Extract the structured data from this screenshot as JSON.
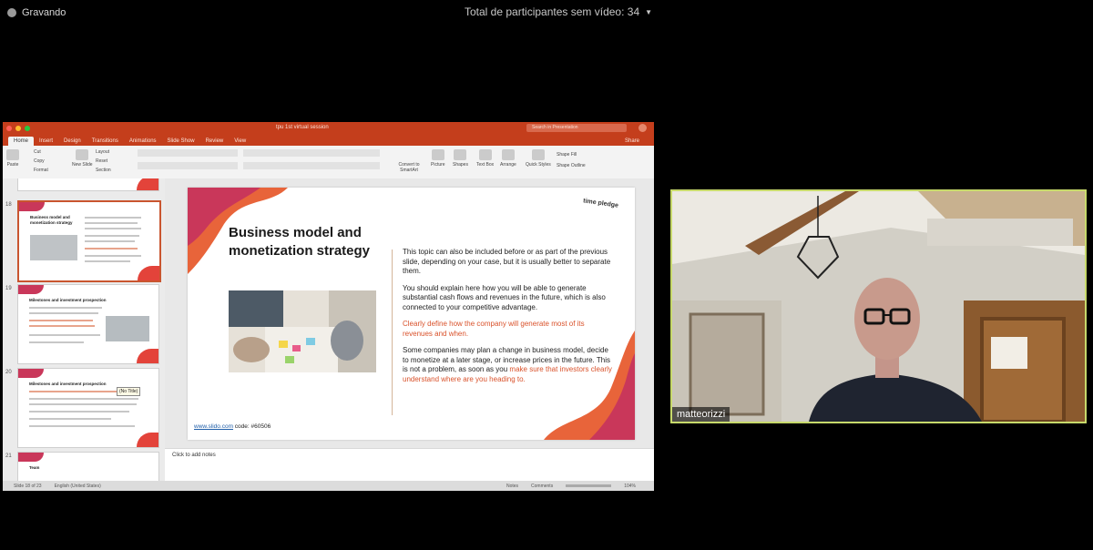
{
  "recording": {
    "label": "Gravando"
  },
  "meeting": {
    "participants_label": "Total de participantes sem vídeo: 34"
  },
  "ppt": {
    "window_title": "tpu 1st virtual session",
    "search_placeholder": "Search in Presentation",
    "tabs": [
      "Home",
      "Insert",
      "Design",
      "Transitions",
      "Animations",
      "Slide Show",
      "Review",
      "View"
    ],
    "active_tab": "Home",
    "share_label": "Share",
    "ribbon": {
      "paste": "Paste",
      "cut": "Cut",
      "copy": "Copy",
      "format": "Format",
      "new_slide": "New Slide",
      "layout": "Layout",
      "reset": "Reset",
      "section": "Section",
      "convert": "Convert to SmartArt",
      "picture": "Picture",
      "shapes": "Shapes",
      "textbox": "Text Box",
      "arrange": "Arrange",
      "quick_styles": "Quick Styles",
      "shape_fill": "Shape Fill",
      "shape_outline": "Shape Outline"
    },
    "thumbnails": [
      {
        "num": "18",
        "title": "Business model and monetization strategy",
        "selected": true
      },
      {
        "num": "19",
        "title": "Milestones and investment prospection",
        "selected": false
      },
      {
        "num": "20",
        "title": "Milestones and investment prospection",
        "selected": false
      },
      {
        "num": "21",
        "title": "Team",
        "selected": false
      }
    ],
    "tooltip": "(No Title)",
    "slide": {
      "title": "Business model and monetization strategy",
      "para1": "This topic can also be included before or as part of the previous slide, depending on your case, but it is usually better to separate them.",
      "para2": "You should explain here how you will be able to generate substantial cash flows and revenues in the future, which is also connected to your competitive advantage.",
      "para3": "Clearly define how the company will generate most of its revenues and when.",
      "para4_a": "Some companies may plan a change in business model, decide to monetize at a later stage, or increase prices in the future. This is not a problem, as soon as you ",
      "para4_b": "make sure that investors clearly understand where are you heading to.",
      "footer_link": "www.slido.com",
      "footer_code": " code: #60506",
      "logo": "time pledge"
    },
    "notes_placeholder": "Click to add notes",
    "status": {
      "slide_of": "Slide 18 of 23",
      "language": "English (United States)",
      "notes": "Notes",
      "comments": "Comments",
      "zoom": "104%"
    }
  },
  "video": {
    "name": "matteorizzi"
  },
  "colors": {
    "accent": "#c43e1c",
    "video_border": "#c7d96b",
    "highlight": "#d9522b"
  }
}
